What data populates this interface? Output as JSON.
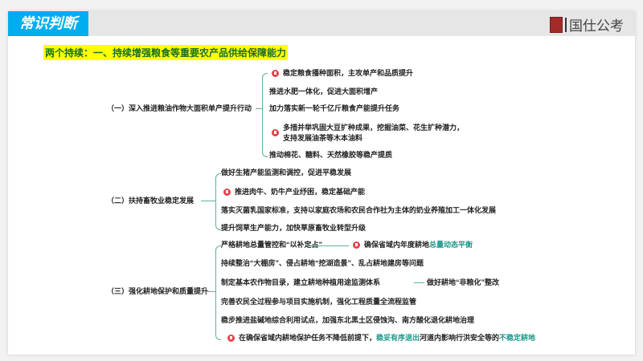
{
  "header": {
    "tab": "常识判断",
    "logo_text": "国仕公考"
  },
  "title": "两个持续：一、持续增强粮食等重要农产品供给保障能力",
  "sections": [
    {
      "label": "（一）深入推进粮油作物大面积单产提升行动",
      "items": [
        "稳定粮食播种面积，主攻单产和品质提升",
        "推进水肥一体化，促进大面积增产",
        "加力落实新一轮千亿斤粮食产能提升任务",
        "多措并举巩固大豆扩种成果，挖掘油菜、花生扩种潜力，",
        "支持发展油茶等木本油料",
        "推动棉花、糖料、天然橡胶等稳产提质"
      ]
    },
    {
      "label": "（二）扶持畜牧业稳定发展",
      "items": [
        "做好生猪产能监测和调控，促进平稳发展",
        "推进肉牛、奶牛产业纾困，稳定基础产能",
        "落实灭菌乳国家标准，支持以家庭农场和农民合作社为主体的奶业养殖加工一体化发展",
        "提升饲草生产能力，加快草原畜牧业转型升级"
      ]
    },
    {
      "label": "（三）强化耕地保护和质量提升",
      "items": [
        "严格耕地总量管控和“以补定占”",
        "持续整治“大棚房”、侵占耕地“挖湖造景”、乱占耕地建房等问题",
        "制定基本农作物目录，建立耕地种植用途监测体系",
        "完善农民全过程参与项目实施机制，强化工程质量全流程监管",
        "稳步推进盐碱地综合利用试点，加强东北黑土区侵蚀沟、南方酸化退化耕地治理"
      ],
      "sub1": {
        "a": "确保省域内年度耕地",
        "b": "总量动态平衡"
      },
      "sub3": "做好耕地“非粮化”整改",
      "last": {
        "a": "在确保省域内耕地保护任务不降低前提下，",
        "b": "稳妥有序退出",
        "c": "河道内影响行洪安全等的",
        "d": "不稳定耕地"
      }
    }
  ],
  "colors": {
    "tab": "#00aeef",
    "highlight": "#ffff00",
    "accent": "#1a9a8a",
    "flag": "#e8404a"
  }
}
